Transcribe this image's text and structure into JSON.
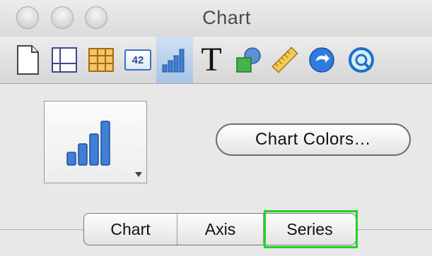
{
  "window": {
    "title": "Chart"
  },
  "toolbar": {
    "items": [
      {
        "icon": "document-icon"
      },
      {
        "icon": "layout-guides-icon"
      },
      {
        "icon": "table-icon"
      },
      {
        "icon": "number-field-icon",
        "label": "42"
      },
      {
        "icon": "bar-chart-icon",
        "active": true
      },
      {
        "icon": "text-icon",
        "label": "T"
      },
      {
        "icon": "shapes-icon"
      },
      {
        "icon": "ruler-icon"
      },
      {
        "icon": "go-arrow-icon"
      },
      {
        "icon": "quicktime-icon"
      }
    ]
  },
  "chart_panel": {
    "chart_type_icon": "bar-chart-icon",
    "chart_colors_label": "Chart Colors…"
  },
  "tabs": {
    "items": [
      "Chart",
      "Axis",
      "Series"
    ],
    "selected": "Series"
  },
  "colors": {
    "highlight": "#22d322",
    "selected_tool": "#a9c4e6"
  }
}
